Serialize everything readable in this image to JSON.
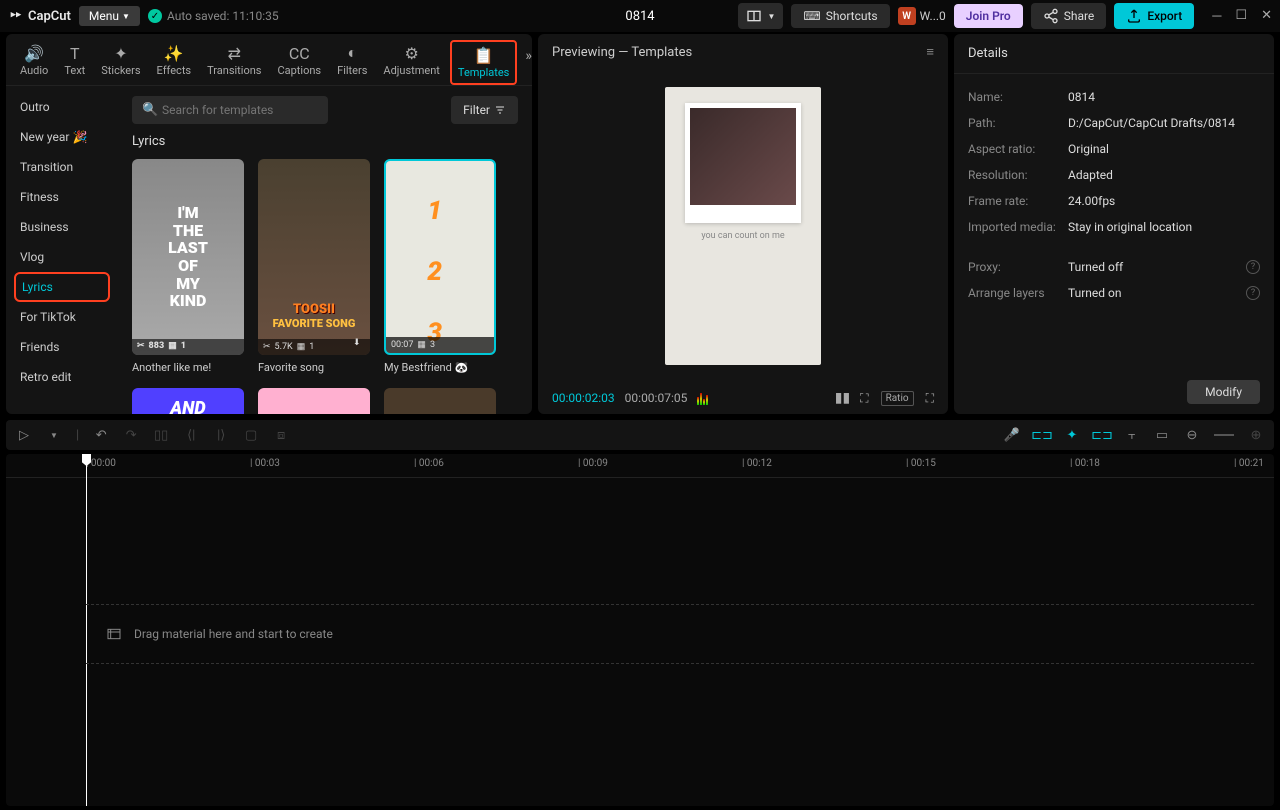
{
  "app": {
    "name": "CapCut",
    "menu": "Menu",
    "autosave": "Auto saved: 11:10:35",
    "project_title": "0814"
  },
  "titlebar": {
    "shortcuts": "Shortcuts",
    "user": "W...0",
    "joinpro": "Join Pro",
    "share": "Share",
    "export": "Export"
  },
  "tabs": [
    "Audio",
    "Text",
    "Stickers",
    "Effects",
    "Transitions",
    "Captions",
    "Filters",
    "Adjustment",
    "Templates"
  ],
  "sidebar": {
    "items": [
      "Outro",
      "New year 🎉",
      "Transition",
      "Fitness",
      "Business",
      "Vlog",
      "Lyrics",
      "For TikTok",
      "Friends",
      "Retro edit"
    ],
    "active": "Lyrics"
  },
  "search": {
    "placeholder": "Search for templates",
    "filter": "Filter"
  },
  "section": {
    "title": "Lyrics"
  },
  "templates": [
    {
      "title": "Another like me!",
      "meta_cut": "883",
      "meta_clips": "1",
      "thumb_text": "I'M\nTHE\nLAST\nOF\nMY\nKIND"
    },
    {
      "title": "Favorite song",
      "meta_cut": "5.7K",
      "meta_clips": "1",
      "thumb_text1": "TOOSII",
      "thumb_text2": "FAVORITE SONG"
    },
    {
      "title": "My Bestfriend 🐼",
      "meta_time": "00:07",
      "meta_clips": "3"
    }
  ],
  "row2_thumb": "AND",
  "preview": {
    "header": "Previewing — Templates",
    "caption": "you can count on me",
    "time_current": "00:00:02:03",
    "time_total": "00:00:07:05",
    "ratio": "Ratio"
  },
  "details": {
    "title": "Details",
    "rows": [
      {
        "label": "Name:",
        "value": "0814"
      },
      {
        "label": "Path:",
        "value": "D:/CapCut/CapCut Drafts/0814"
      },
      {
        "label": "Aspect ratio:",
        "value": "Original"
      },
      {
        "label": "Resolution:",
        "value": "Adapted"
      },
      {
        "label": "Frame rate:",
        "value": "24.00fps"
      },
      {
        "label": "Imported media:",
        "value": "Stay in original location"
      },
      {
        "label": "Proxy:",
        "value": "Turned off",
        "info": true
      },
      {
        "label": "Arrange layers",
        "value": "Turned on",
        "info": true
      }
    ],
    "modify": "Modify"
  },
  "timeline": {
    "marks": [
      "00:00",
      "00:03",
      "00:06",
      "00:09",
      "00:12",
      "00:15",
      "00:18",
      "00:21"
    ],
    "dropzone": "Drag material here and start to create"
  }
}
